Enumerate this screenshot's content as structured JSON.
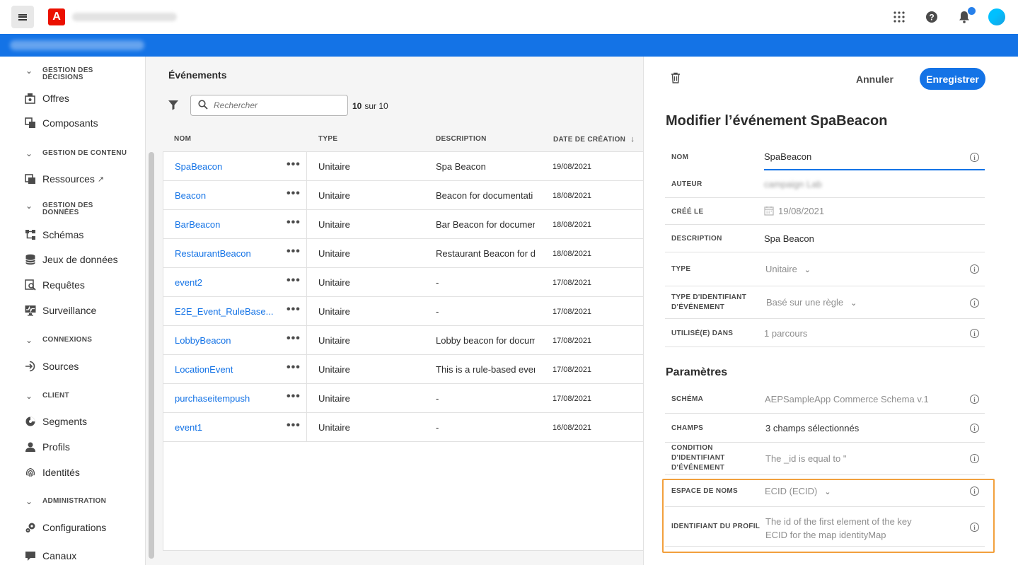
{
  "topbar": {
    "logo_letter": "A",
    "icons": [
      "apps-grid-icon",
      "help-icon",
      "bell-icon",
      "avatar"
    ]
  },
  "sidebar": {
    "sections": [
      {
        "title_lines": [
          "GESTION DES",
          "DÉCISIONS"
        ],
        "items": [
          {
            "label": "Offres",
            "icon": "offers-icon"
          },
          {
            "label": "Composants",
            "icon": "components-icon"
          }
        ]
      },
      {
        "title_lines": [
          "GESTION DE CONTENU"
        ],
        "items": [
          {
            "label": "Ressources",
            "icon": "assets-icon",
            "external": true
          }
        ]
      },
      {
        "title_lines": [
          "GESTION DES",
          "DONNÉES"
        ],
        "items": [
          {
            "label": "Schémas",
            "icon": "schemas-icon"
          },
          {
            "label": "Jeux de données",
            "icon": "datasets-icon"
          },
          {
            "label": "Requêtes",
            "icon": "queries-icon"
          },
          {
            "label": "Surveillance",
            "icon": "monitoring-icon"
          }
        ]
      },
      {
        "title_lines": [
          "CONNEXIONS"
        ],
        "items": [
          {
            "label": "Sources",
            "icon": "sources-icon"
          }
        ]
      },
      {
        "title_lines": [
          "CLIENT"
        ],
        "items": [
          {
            "label": "Segments",
            "icon": "segments-icon"
          },
          {
            "label": "Profils",
            "icon": "profiles-icon"
          },
          {
            "label": "Identités",
            "icon": "identities-icon"
          }
        ]
      },
      {
        "title_lines": [
          "ADMINISTRATION"
        ],
        "items": [
          {
            "label": "Configurations",
            "icon": "configurations-icon"
          },
          {
            "label": "Canaux",
            "icon": "channels-icon"
          }
        ]
      }
    ]
  },
  "events": {
    "title": "Événements",
    "search_placeholder": "Rechercher",
    "count_bold": "10",
    "count_rest": "sur 10",
    "columns": [
      "NOM",
      "TYPE",
      "DESCRIPTION",
      "DATE DE CRÉATION"
    ],
    "sort_arrow": "↓",
    "rows": [
      {
        "name": "SpaBeacon",
        "type": "Unitaire",
        "description": "Spa Beacon",
        "date": "19/08/2021"
      },
      {
        "name": "Beacon",
        "type": "Unitaire",
        "description": "Beacon for documentati",
        "date": "18/08/2021"
      },
      {
        "name": "BarBeacon",
        "type": "Unitaire",
        "description": "Bar Beacon for documer",
        "date": "18/08/2021"
      },
      {
        "name": "RestaurantBeacon",
        "type": "Unitaire",
        "description": "Restaurant Beacon for dc",
        "date": "18/08/2021"
      },
      {
        "name": "event2",
        "type": "Unitaire",
        "description": "-",
        "date": "17/08/2021"
      },
      {
        "name": "E2E_Event_RuleBase...",
        "type": "Unitaire",
        "description": "-",
        "date": "17/08/2021"
      },
      {
        "name": "LobbyBeacon",
        "type": "Unitaire",
        "description": "Lobby beacon for docum",
        "date": "17/08/2021"
      },
      {
        "name": "LocationEvent",
        "type": "Unitaire",
        "description": "This is a rule-based even",
        "date": "17/08/2021"
      },
      {
        "name": "purchaseitempush",
        "type": "Unitaire",
        "description": "-",
        "date": "17/08/2021"
      },
      {
        "name": "event1",
        "type": "Unitaire",
        "description": "-",
        "date": "16/08/2021"
      }
    ]
  },
  "panel": {
    "cancel_label": "Annuler",
    "save_label": "Enregistrer",
    "title": "Modifier l’événement SpaBeacon",
    "fields": {
      "name_label": "NOM",
      "name_value": "SpaBeacon",
      "author_label": "AUTEUR",
      "author_value": "campaign Lab",
      "created_label": "CRÉÉ LE",
      "created_value": "19/08/2021",
      "description_label": "DESCRIPTION",
      "description_value": "Spa Beacon",
      "type_label": "TYPE",
      "type_value": "Unitaire",
      "idtype_label_1": "TYPE D'IDENTIFIANT",
      "idtype_label_2": "D'ÉVÉNEMENT",
      "idtype_value": "Basé sur une règle",
      "used_label": "UTILISÉ(E) DANS",
      "used_value": "1 parcours"
    },
    "parameters_title": "Paramètres",
    "params": {
      "schema_label": "SCHÉMA",
      "schema_value": "AEPSampleApp Commerce Schema v.1",
      "fields_label": "CHAMPS",
      "fields_value": "3 champs sélectionnés",
      "condition_label_1": "CONDITION",
      "condition_label_2": "D'IDENTIFIANT",
      "condition_label_3": "D'ÉVÉNEMENT",
      "condition_value": "The _id is equal to \"",
      "namespace_label": "ESPACE DE NOMS",
      "namespace_value": "ECID (ECID)",
      "profile_id_label": "IDENTIFIANT DU PROFIL",
      "profile_id_value_1": "The id of the first element of the key",
      "profile_id_value_2": "ECID for the map identityMap"
    }
  },
  "colors": {
    "accent": "#1473e6",
    "highlight": "#f2a03d",
    "adobe_red": "#eb1000"
  }
}
